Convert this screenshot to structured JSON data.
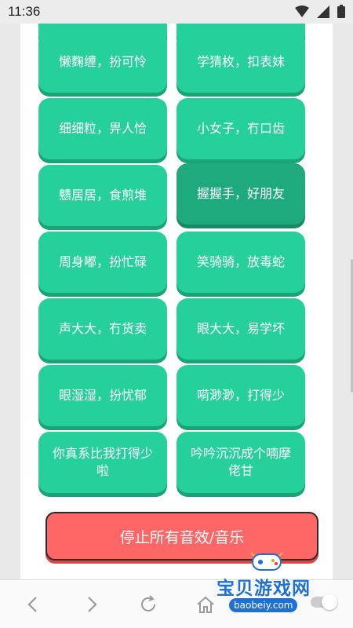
{
  "status_bar": {
    "time": "11:36"
  },
  "sound_buttons": [
    {
      "label": "懒麴缠，扮可怜"
    },
    {
      "label": "学猜枚，扣表妹"
    },
    {
      "label": "细细粒，畀人恰"
    },
    {
      "label": "小女子，冇口齿"
    },
    {
      "label": "戆居居，食煎堆"
    },
    {
      "label": "握握手，好朋友",
      "active": true
    },
    {
      "label": "周身嘟，扮忙碌"
    },
    {
      "label": "笑骑骑，放毒蛇"
    },
    {
      "label": "声大大，冇货卖"
    },
    {
      "label": "眼大大，易学坏"
    },
    {
      "label": "眼湿湿，扮忧郁"
    },
    {
      "label": "嗬渺渺，打得少"
    },
    {
      "label": "你真系比我打得少啦"
    },
    {
      "label": "吟吟沉沉成个喃摩佬甘"
    }
  ],
  "stop_button": {
    "label": "停止所有音效/音乐"
  },
  "watermark": {
    "name": "宝贝游戏网",
    "url": "baobeiy.com"
  },
  "icons": {
    "wifi": "wifi-icon",
    "signal": "signal-icon",
    "battery": "battery-icon",
    "back": "chevron-left-icon",
    "forward": "chevron-right-icon",
    "reload": "reload-icon",
    "home": "home-icon"
  },
  "colors": {
    "button": "#26d09a",
    "button_active": "#1faa7d",
    "stop": "#ff6767"
  }
}
